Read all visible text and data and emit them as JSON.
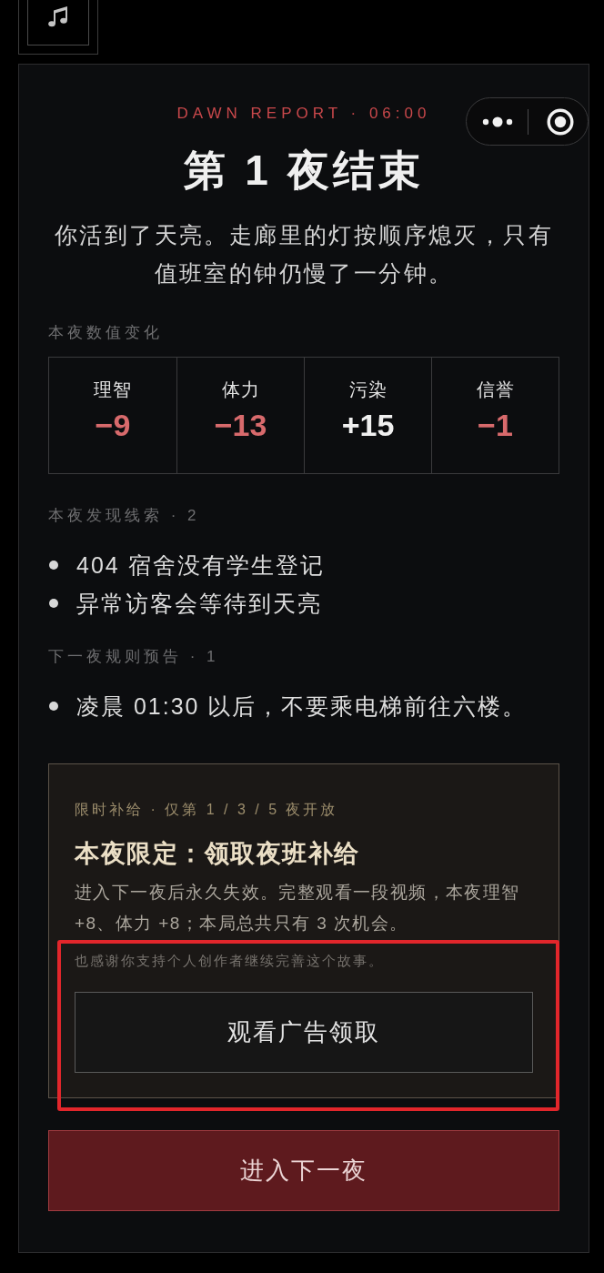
{
  "header": {
    "eyebrow": "DAWN REPORT · 06:00",
    "title": "第 1 夜结束",
    "summary": "你活到了天亮。走廊里的灯按顺序熄灭，只有值班室的钟仍慢了一分钟。"
  },
  "stats": {
    "heading": "本夜数值变化",
    "items": [
      {
        "label": "理智",
        "value": "−9",
        "color": "#d86a6c"
      },
      {
        "label": "体力",
        "value": "−13",
        "color": "#d86a6c"
      },
      {
        "label": "污染",
        "value": "+15",
        "color": "#f0f0f0"
      },
      {
        "label": "信誉",
        "value": "−1",
        "color": "#d86a6c"
      }
    ]
  },
  "clues": {
    "heading": "本夜发现线索 · 2",
    "items": [
      "404 宿舍没有学生登记",
      "异常访客会等待到天亮"
    ]
  },
  "rules": {
    "heading": "下一夜规则预告 · 1",
    "items": [
      "凌晨 01:30 以后，不要乘电梯前往六楼。"
    ]
  },
  "supply": {
    "eyebrow": "限时补给 · 仅第 1 / 3 / 5 夜开放",
    "title": "本夜限定：领取夜班补给",
    "body": "进入下一夜后永久失效。完整观看一段视频，本夜理智 +8、体力 +8；本局总共只有 3 次机会。",
    "note": "也感谢你支持个人创作者继续完善这个故事。",
    "button": "观看广告领取"
  },
  "next_button": "进入下一夜"
}
